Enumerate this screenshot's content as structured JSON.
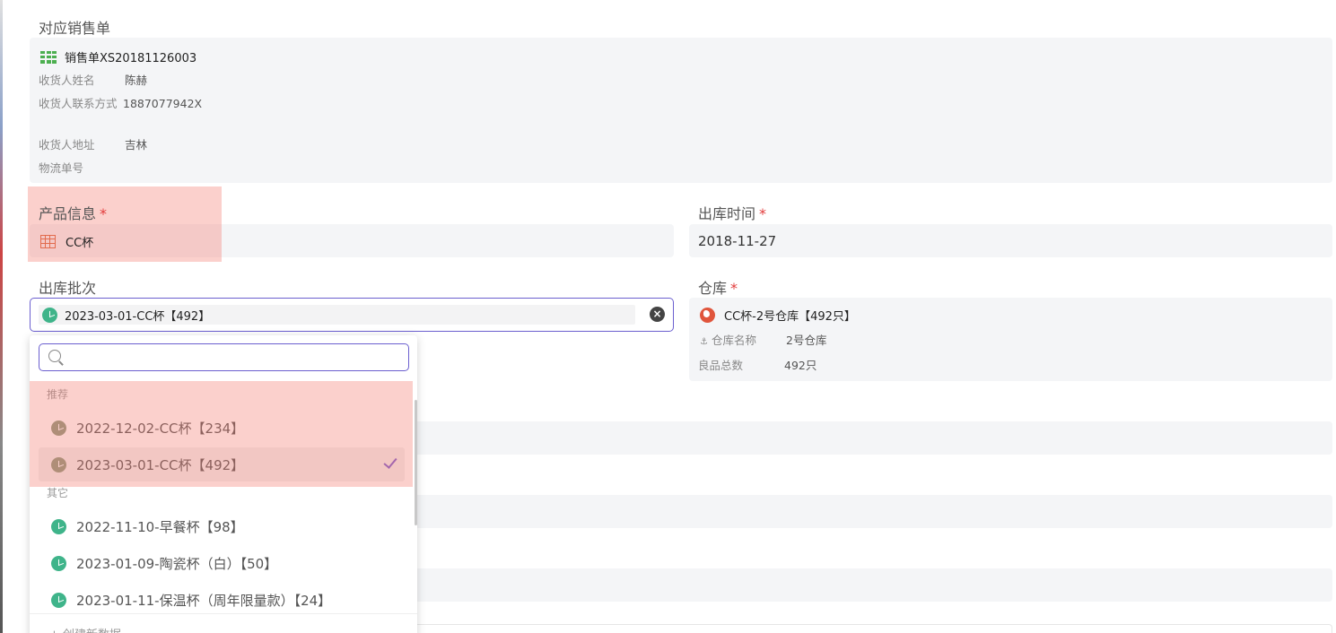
{
  "sales_order": {
    "label": "对应销售单",
    "title": "销售单XS20181126003",
    "fields": [
      {
        "key": "收货人姓名",
        "value": "陈赫"
      },
      {
        "key": "收货人联系方式",
        "value": "1887077942X"
      },
      {
        "key": "收货人地址",
        "value": "吉林"
      },
      {
        "key": "物流单号",
        "value": ""
      }
    ]
  },
  "product": {
    "label": "产品信息",
    "required": "*",
    "value": "CC杯"
  },
  "out_time": {
    "label": "出库时间",
    "required": "*",
    "value": "2018-11-27"
  },
  "batch": {
    "label": "出库批次",
    "value": "2023-03-01-CC杯【492】",
    "clear_icon": "×",
    "search_placeholder": "",
    "recommended_label": "推荐",
    "recommended": [
      {
        "text": "2022-12-02-CC杯【234】",
        "selected": false
      },
      {
        "text": "2023-03-01-CC杯【492】",
        "selected": true
      }
    ],
    "other_label": "其它",
    "others": [
      {
        "text": "2022-11-10-早餐杯【98】"
      },
      {
        "text": "2023-01-09-陶瓷杯（白）【50】"
      },
      {
        "text": "2023-01-11-保温杯（周年限量款）【24】"
      }
    ],
    "footer_text": "+ 创建新数据"
  },
  "warehouse": {
    "label": "仓库",
    "required": "*",
    "title": "CC杯-2号仓库【492只】",
    "name_key": "仓库名称",
    "name_value": "2号仓库",
    "total_key": "良品总数",
    "total_value": "492只"
  },
  "colors": {
    "accent": "#6b5fcf",
    "required": "#e23b3b",
    "highlight": "#f4786e",
    "batch_icon": "#3fb48a",
    "order_icon": "#4caf50",
    "product_icon": "#e26b4d",
    "warehouse_icon": "#e0553c"
  },
  "icons": {
    "order": "grid-table-icon",
    "product": "table-icon",
    "batch": "pie-chart-icon",
    "warehouse": "globe-icon",
    "search": "search-icon",
    "clear": "clear-icon",
    "selected": "checkmark-icon"
  }
}
